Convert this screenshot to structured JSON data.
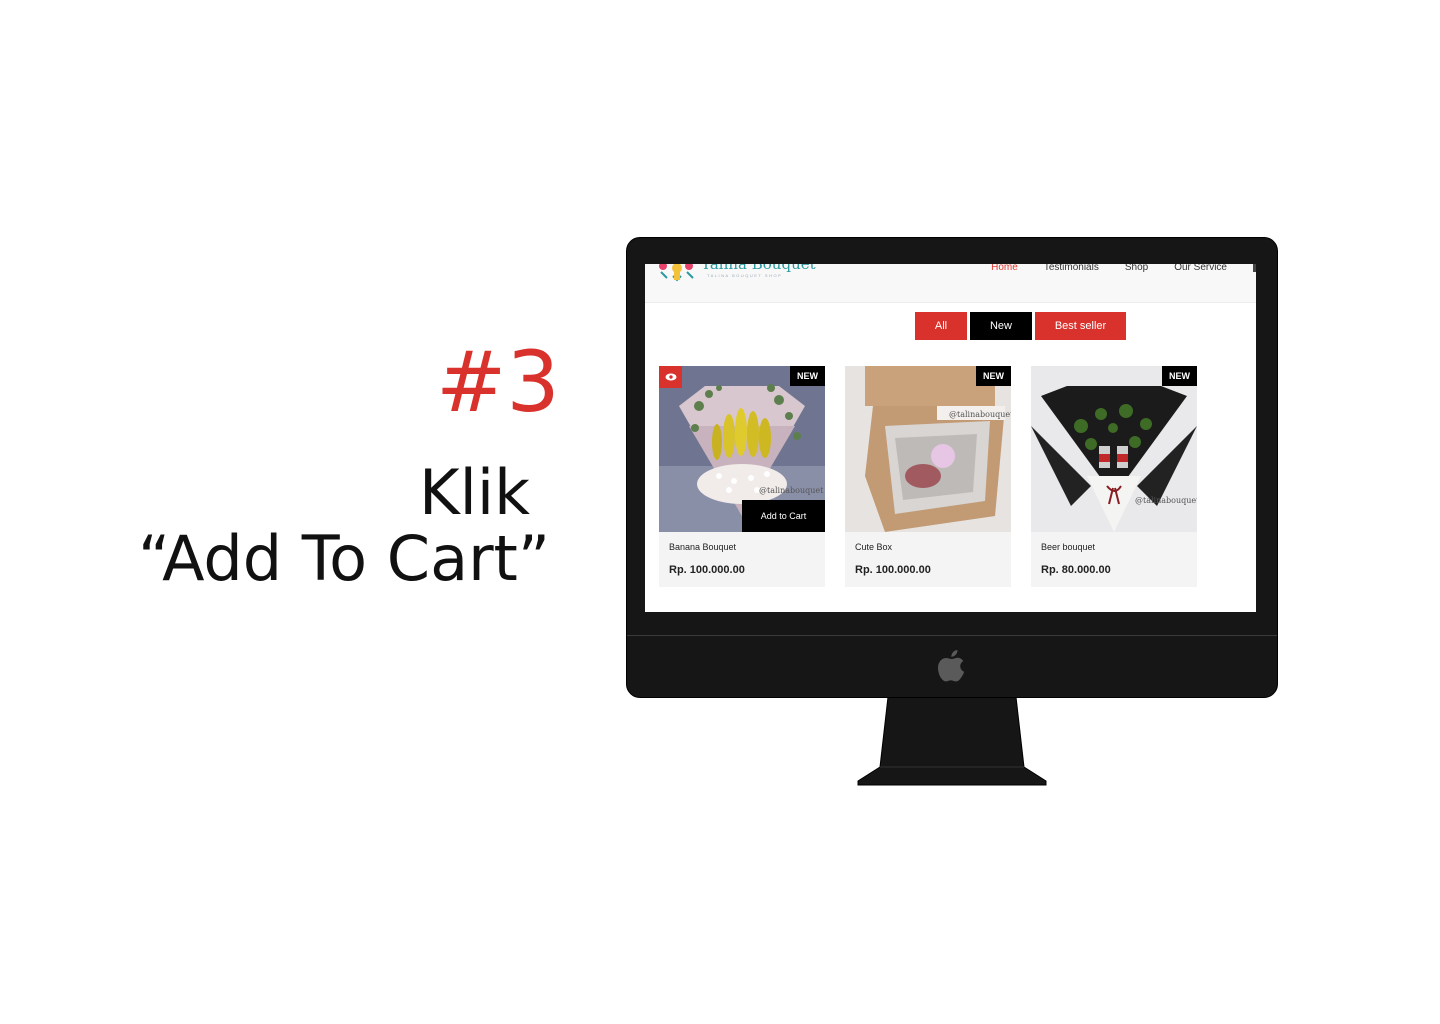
{
  "slide": {
    "step_number": "#3",
    "instruction_line1": "Klik",
    "instruction_line2": "“Add To Cart”",
    "accent_color": "#d9322c"
  },
  "site": {
    "logo_text": "Talina Bouquet",
    "logo_tagline": "TALINA BOUQUET SHOP",
    "nav": [
      "Home",
      "Testimonials",
      "Shop",
      "Our Service"
    ],
    "active_nav": "Home"
  },
  "filters": {
    "all": "All",
    "new": "New",
    "best_seller": "Best seller",
    "selected": "New"
  },
  "products": [
    {
      "name": "Banana Bouquet",
      "price": "Rp. 100.000.00",
      "badge": "NEW",
      "add_to_cart": "Add to Cart",
      "watermark": "@talinabouquet",
      "icon": "eye-icon"
    },
    {
      "name": "Cute Box",
      "price": "Rp. 100.000.00",
      "badge": "NEW",
      "watermark": "@talinabouquet"
    },
    {
      "name": "Beer bouquet",
      "price": "Rp. 80.000.00",
      "badge": "NEW",
      "watermark": "@talinabouquet"
    }
  ],
  "device_icon": "apple-logo-icon"
}
